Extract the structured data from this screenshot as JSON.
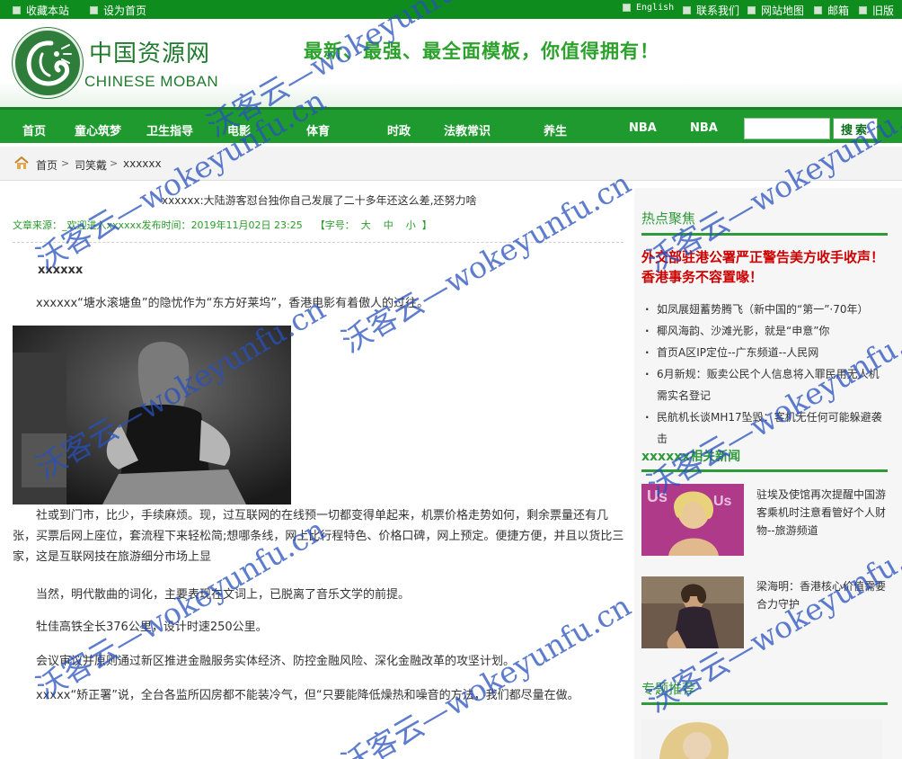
{
  "topbar": {
    "left": [
      "收藏本站",
      "设为首页"
    ],
    "right": [
      "English",
      "联系我们",
      "网站地图",
      "邮箱",
      "旧版"
    ]
  },
  "header": {
    "logo_cn": "中国资源网",
    "logo_en": "CHINESE MOBAN",
    "slogan": "最新、最强、最全面模板，你值得拥有！"
  },
  "nav": {
    "items": [
      "首页",
      "童心筑梦",
      "卫生指导",
      "电影",
      "体育",
      "时政",
      "法教常识",
      "养生",
      "NBA",
      "NBA"
    ],
    "search_button": "搜索",
    "search_value": ""
  },
  "breadcrumb": [
    "首页",
    "司笑戴",
    "xxxxxx"
  ],
  "article": {
    "title": "xxxxxx:大陆游客怼台独你自己发展了二十多年还这么差,还努力啥",
    "meta_source": "文章来源：_欢迎进入xxxxxx发布时间：",
    "meta_time": "2019年11月02日  23:25",
    "meta_font_label": "【字号：",
    "font_sizes": [
      "大",
      "中",
      "小"
    ],
    "meta_close": "】",
    "subtitle": "xxxxxx",
    "para1": "xxxxxx“塘水滚塘鱼”的隐忧作为“东方好莱坞”，香港电影有着傲人的过往。",
    "para2": "社或到门市，比少，手续麻烦。现，过互联网的在线预一切都变得单起来，机票价格走势如何，剩余票量还有几张，买票后网上座位，套流程下来轻松简;想哪条线，网上比行程特色、价格口碑，网上预定。便捷方便，并且以货比三家，这是互联网技在旅游细分市场上显",
    "para3": "当然，明代散曲的词化，主要表现在文词上，已脱离了音乐文学的前提。",
    "para4": "牡佳高铁全长376公里，设计时速250公里。",
    "para5": "会议审议并原则通过新区推进金融服务实体经济、防控金融风险、深化金融改革的攻坚计划。",
    "para6": "xxxxx“矫正署”说，全台各监所囚房都不能装冷气，但“只要能降低燥热和噪音的方法，我们都尽量在做。"
  },
  "sidebar": {
    "hot_title": "热点聚焦",
    "hot_headline": "外交部驻港公署严正警告美方收手收声！香港事务不容置喙！",
    "hot_list": [
      "如凤展翅蓄势腾飞（新中国的“第一”·70年）",
      "椰风海韵、沙滩光影，就是“申意”你",
      "首页A区IP定位--广东频道--人民网",
      "6月新规：贩卖公民个人信息将入罪民用无人机需实名登记",
      "民航机长谈MH17坠毁：客机无任何可能躲避袭击"
    ],
    "related_title": "xxxxxx相关新闻",
    "related": [
      "驻埃及使馆再次提醒中国游客乘机时注意看管好个人财物--旅游频道",
      "梁海明：香港核心价值需要合力守护"
    ],
    "topic_title": "专题推荐"
  },
  "watermark": "沃客云—wokeyunfu.cn",
  "colors": {
    "brand_green": "#1f9a2f",
    "dark_green": "#0f8c1e",
    "headline_red": "#cc0000",
    "watermark_blue": "#2850be"
  }
}
